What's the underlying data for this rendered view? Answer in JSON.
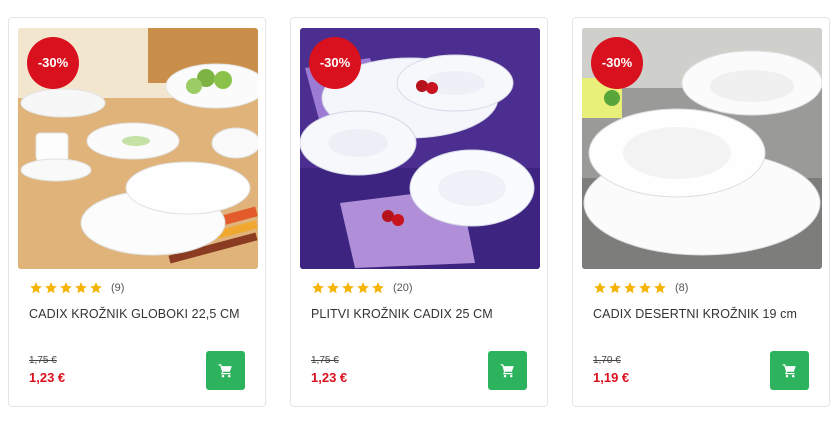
{
  "colors": {
    "sale_badge": "#d9101d",
    "price": "#d9101d",
    "cart_button": "#2db35d",
    "star": "#f5b400"
  },
  "products": [
    {
      "discount": "-30%",
      "rating": 5,
      "reviews": "(9)",
      "title": "CADIX KROŽNIK GLOBOKI 22,5 CM",
      "old_price": "1,75 €",
      "price": "1,23 €",
      "cart_icon": "shopping-cart-icon"
    },
    {
      "discount": "-30%",
      "rating": 5,
      "reviews": "(20)",
      "title": "PLITVI KROŽNIK CADIX 25 CM",
      "old_price": "1,75 €",
      "price": "1,23 €",
      "cart_icon": "shopping-cart-icon"
    },
    {
      "discount": "-30%",
      "rating": 5,
      "reviews": "(8)",
      "title": "CADIX DESERTNI KROŽNIK 19 cm",
      "old_price": "1,70 €",
      "price": "1,19 €",
      "cart_icon": "shopping-cart-icon"
    }
  ]
}
